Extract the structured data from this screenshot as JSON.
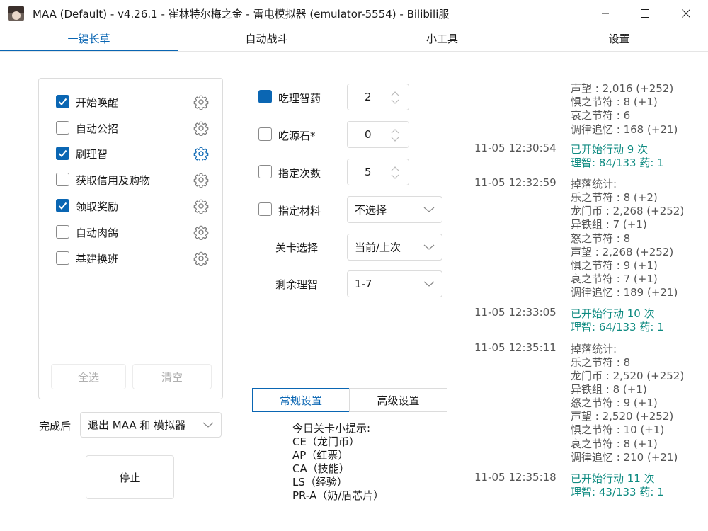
{
  "window": {
    "title": "MAA (Default) - v4.26.1 - 崔林特尔梅之金 - 雷电模拟器 (emulator-5554) - Bilibili服",
    "controls": [
      "minimize-icon",
      "maximize-icon",
      "close-icon"
    ]
  },
  "tabs": [
    {
      "label": "一键长草",
      "active": true
    },
    {
      "label": "自动战斗",
      "active": false
    },
    {
      "label": "小工具",
      "active": false
    },
    {
      "label": "设置",
      "active": false
    }
  ],
  "colors": {
    "accent": "#0a66b3",
    "log_accent": "#0d8a80",
    "checkbox_checked": "#0a66b3"
  },
  "tasks": [
    {
      "label": "开始唤醒",
      "checked": true
    },
    {
      "label": "自动公招",
      "checked": false
    },
    {
      "label": "刷理智",
      "checked": true,
      "gear_highlight": true
    },
    {
      "label": "获取信用及购物",
      "checked": false
    },
    {
      "label": "领取奖励",
      "checked": true
    },
    {
      "label": "自动肉鸽",
      "checked": false
    },
    {
      "label": "基建换班",
      "checked": false
    }
  ],
  "task_buttons": {
    "select_all": "全选",
    "clear": "清空"
  },
  "after_completion": {
    "label": "完成后",
    "value": "退出 MAA 和 模拟器"
  },
  "stop_button": "停止",
  "fight": {
    "medicine": {
      "label": "吃理智药",
      "checked": true,
      "value": "2"
    },
    "stone": {
      "label": "吃源石*",
      "checked": false,
      "value": "0"
    },
    "times": {
      "label": "指定次数",
      "checked": false,
      "value": "5"
    },
    "material": {
      "label": "指定材料",
      "checked": false,
      "value": "不选择"
    },
    "stage": {
      "label": "关卡选择",
      "value": "当前/上次"
    },
    "remaining": {
      "label": "剩余理智",
      "value": "1-7"
    }
  },
  "settings_tabs": [
    {
      "label": "常规设置",
      "active": true
    },
    {
      "label": "高级设置",
      "active": false
    }
  ],
  "tips": {
    "title": "今日关卡小提示:",
    "lines": [
      "CE（龙门币）",
      "AP（红票）",
      "CA（技能）",
      "LS（经验）",
      "PR-A（奶/盾芯片）"
    ]
  },
  "log": {
    "top_tail": [
      "声望 : 2,016 (+252)",
      "惧之节符 : 8 (+1)",
      "哀之节符 : 6",
      "调律追忆 : 168 (+21)"
    ],
    "entries": [
      {
        "time": "11-05  12:30:54",
        "lines": [
          "已开始行动 9 次",
          "理智: 84/133   药: 1"
        ],
        "accent": true
      },
      {
        "time": "11-05  12:32:59",
        "lines": [
          "掉落统计:",
          "乐之节符 : 8 (+2)",
          "龙门币 : 2,268 (+252)",
          "异铁组 : 7 (+1)",
          "怒之节符 : 8",
          "声望 : 2,268 (+252)",
          "惧之节符 : 9 (+1)",
          "哀之节符 : 7 (+1)",
          "调律追忆 : 189 (+21)"
        ],
        "accent": false
      },
      {
        "time": "11-05  12:33:05",
        "lines": [
          "已开始行动 10 次",
          "理智: 64/133   药: 1"
        ],
        "accent": true
      },
      {
        "time": "11-05  12:35:11",
        "lines": [
          "掉落统计:",
          "乐之节符 : 8",
          "龙门币 : 2,520 (+252)",
          "异铁组 : 8 (+1)",
          "怒之节符 : 9 (+1)",
          "声望 : 2,520 (+252)",
          "惧之节符 : 10 (+1)",
          "哀之节符 : 8 (+1)",
          "调律追忆 : 210 (+21)"
        ],
        "accent": false
      },
      {
        "time": "11-05  12:35:18",
        "lines": [
          "已开始行动 11 次",
          "理智: 43/133   药: 1"
        ],
        "accent": true
      }
    ]
  }
}
